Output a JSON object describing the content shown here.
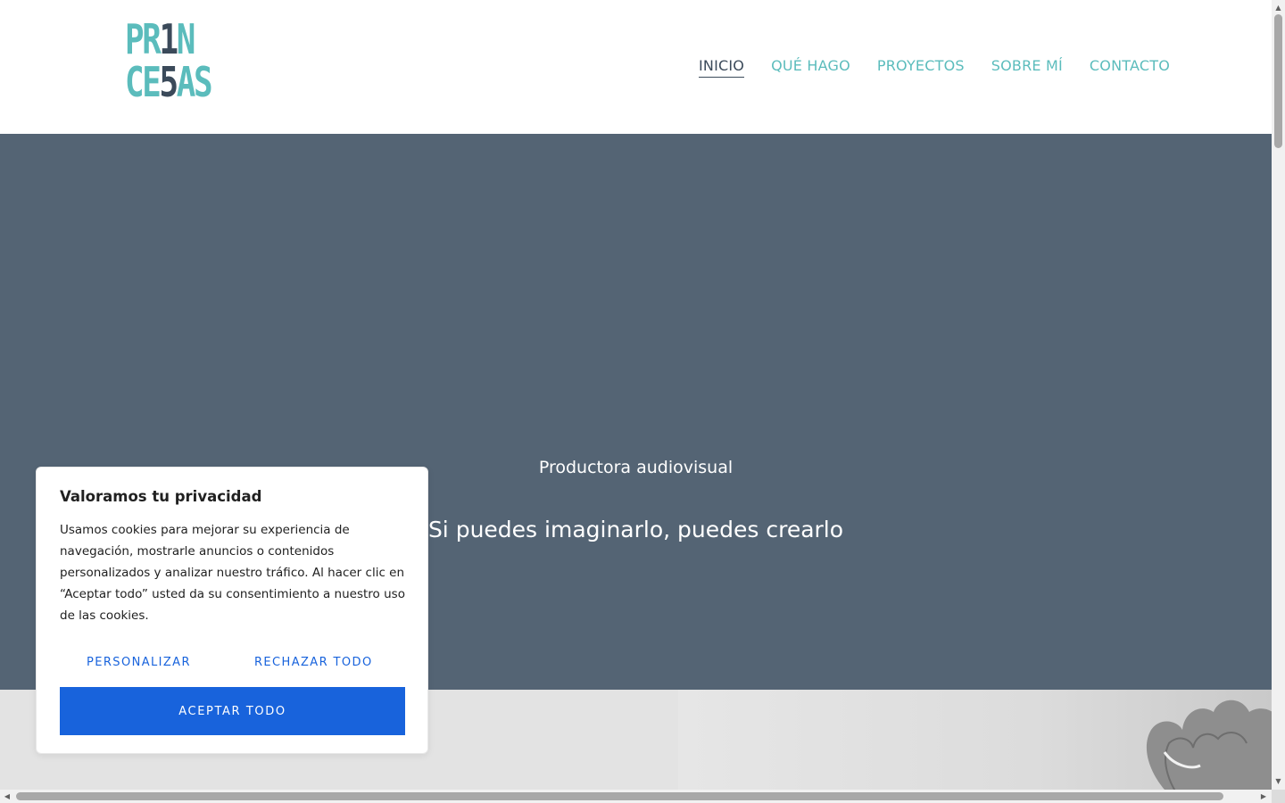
{
  "header": {
    "logo": {
      "line1_a": "PR",
      "line1_b": "1",
      "line1_c": "N",
      "line2_a": "CE",
      "line2_b": "5",
      "line2_c": "AS"
    },
    "nav": [
      {
        "label": "INICIO",
        "active": true
      },
      {
        "label": "QUÉ HAGO",
        "active": false
      },
      {
        "label": "PROYECTOS",
        "active": false
      },
      {
        "label": "SOBRE MÍ",
        "active": false
      },
      {
        "label": "CONTACTO",
        "active": false
      }
    ]
  },
  "hero": {
    "subtitle": "Productora audiovisual",
    "title": "Si puedes imaginarlo, puedes crearlo"
  },
  "cookie_banner": {
    "title": "Valoramos tu privacidad",
    "text": "Usamos cookies para mejorar su experiencia de navegación, mostrarle anuncios o contenidos personalizados y analizar nuestro tráfico. Al hacer clic en “Aceptar todo” usted da su consentimiento a nuestro uso de las cookies.",
    "customize_label": "PERSONALIZAR",
    "reject_label": "RECHAZAR TODO",
    "accept_label": "ACEPTAR TODO"
  },
  "colors": {
    "accent": "#5bbcbc",
    "dark": "#3b4a5a",
    "hero_bg": "#546474",
    "cookie_blue": "#1863dc"
  },
  "icons": {
    "scroll_up": "triangle-up-icon",
    "scroll_down": "triangle-down-icon",
    "scroll_left": "triangle-left-icon",
    "scroll_right": "triangle-right-icon"
  }
}
